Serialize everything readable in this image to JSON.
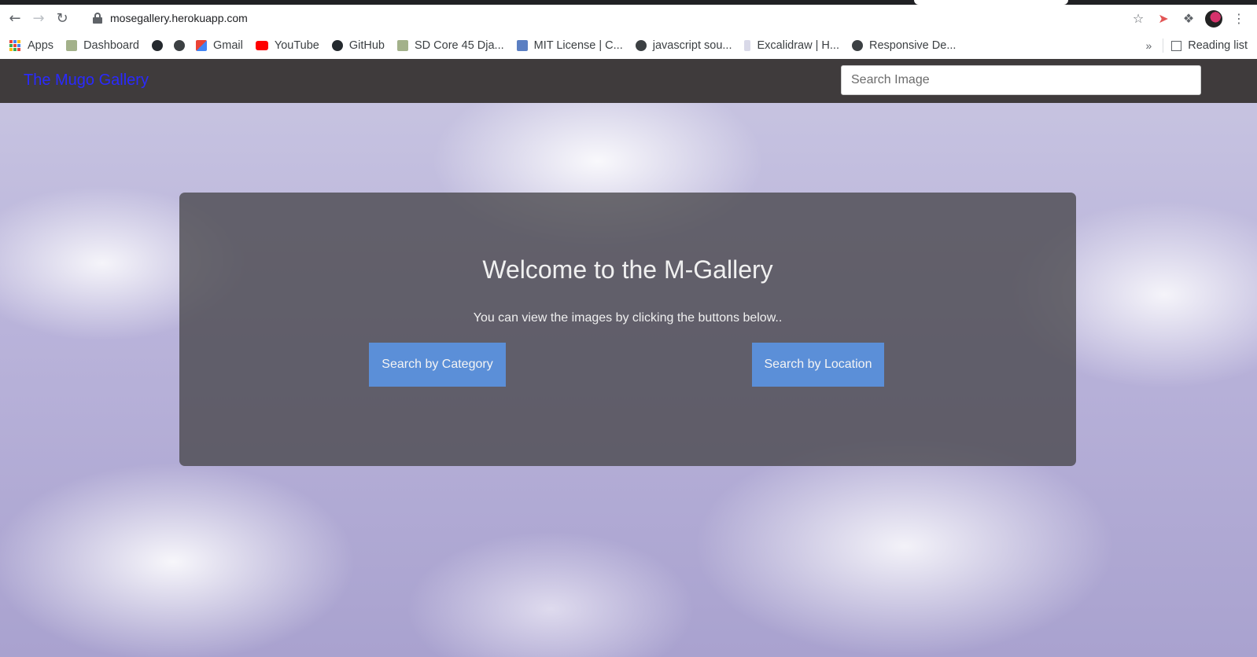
{
  "browser": {
    "url": "mosegallery.herokuapp.com",
    "bookmarks": [
      {
        "label": "Apps",
        "icon": "apps-grid-icon"
      },
      {
        "label": "Dashboard",
        "icon": "dashboard-favicon-icon"
      },
      {
        "label": "",
        "icon": "github-icon"
      },
      {
        "label": "",
        "icon": "globe-icon"
      },
      {
        "label": "Gmail",
        "icon": "gmail-icon"
      },
      {
        "label": "YouTube",
        "icon": "youtube-icon"
      },
      {
        "label": "GitHub",
        "icon": "github-icon"
      },
      {
        "label": "SD Core 45 Dja...",
        "icon": "django-favicon-icon"
      },
      {
        "label": "MIT License | C...",
        "icon": "code-favicon-icon"
      },
      {
        "label": "javascript sou...",
        "icon": "globe-icon"
      },
      {
        "label": "Excalidraw | H...",
        "icon": "excalidraw-icon"
      },
      {
        "label": "Responsive De...",
        "icon": "globe-icon"
      }
    ],
    "reading_list": "Reading list"
  },
  "navbar": {
    "brand": "The Mugo Gallery",
    "search_placeholder": "Search Image"
  },
  "hero": {
    "title": "Welcome to the M-Gallery",
    "subtitle": "You can view the images by clicking the buttons below..",
    "category_button": "Search by Category",
    "location_button": "Search by Location"
  },
  "colors": {
    "navbar_bg": "#3f3b3c",
    "brand_link": "#2a2aff",
    "button_bg": "#5b8fd8",
    "jumbotron_bg": "rgba(72,70,74,0.78)"
  }
}
